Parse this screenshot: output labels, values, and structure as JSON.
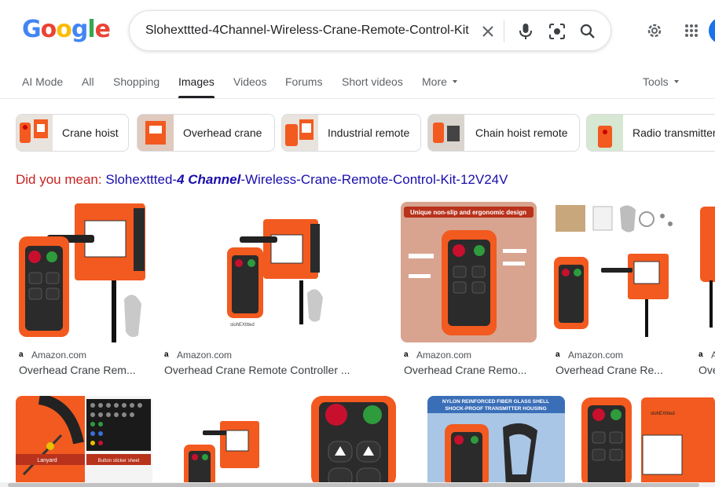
{
  "logo": {
    "letters": [
      "G",
      "o",
      "o",
      "g",
      "l",
      "e"
    ]
  },
  "search": {
    "query": "Slohexttted-4Channel-Wireless-Crane-Remote-Control-Kit-",
    "clear_icon": "close-icon",
    "voice_icon": "microphone-icon",
    "lens_icon": "camera-lens-icon",
    "search_icon": "search-icon"
  },
  "header_icons": {
    "settings": "gear-icon",
    "apps": "apps-grid-icon"
  },
  "tabs": [
    {
      "label": "AI Mode"
    },
    {
      "label": "All"
    },
    {
      "label": "Shopping"
    },
    {
      "label": "Images",
      "active": true
    },
    {
      "label": "Videos"
    },
    {
      "label": "Forums"
    },
    {
      "label": "Short videos"
    },
    {
      "label": "More"
    }
  ],
  "tools_label": "Tools",
  "chips": [
    {
      "label": "Crane hoist"
    },
    {
      "label": "Overhead crane"
    },
    {
      "label": "Industrial remote"
    },
    {
      "label": "Chain hoist remote"
    },
    {
      "label": "Radio transmitter"
    }
  ],
  "did_you_mean": {
    "prefix": "Did you mean:",
    "part1": "Slohexttted-",
    "part2": "4 Channel",
    "part3": "-Wireless-Crane-Remote-Control-Kit-12V24V"
  },
  "results": [
    {
      "source": "Amazon.com",
      "title": "Overhead Crane Rem..."
    },
    {
      "source": "Amazon.com",
      "title": "Overhead Crane Remote Controller ..."
    },
    {
      "source": "Amazon.com",
      "title": "Overhead Crane Remo..."
    },
    {
      "source": "Amazon.com",
      "title": "Overhead Crane Re..."
    },
    {
      "source": "A",
      "title": "Ove"
    }
  ],
  "image_text": {
    "unique_banner": "Unique non-slip and ergonomic design",
    "nylon_banner_1": "NYLON REINFORCED FIBER GLASS SHELL",
    "nylon_banner_2": "SHOCK-PROOF TRANSMITTER HOUSING",
    "lanyard": "Lanyard",
    "sticker_sheet": "Button sticker sheet",
    "brand": "slohEXttted"
  },
  "colors": {
    "brand_orange": "#f25a1f",
    "remote_dark": "#2b2b2b",
    "link_blue": "#1a0dab",
    "did_you_mean_red": "#c5221f"
  }
}
